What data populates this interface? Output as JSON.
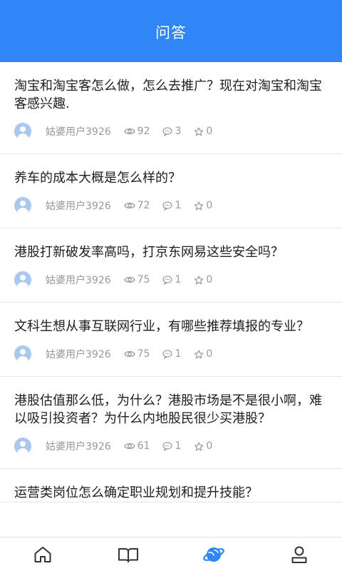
{
  "header": {
    "title": "问答"
  },
  "questions": [
    {
      "title": "淘宝和淘宝客怎么做，怎么去推广？现在对淘宝和淘宝客感兴趣.",
      "user": "姑婆用户3926",
      "views": "92",
      "comments": "3",
      "favorites": "0"
    },
    {
      "title": "养车的成本大概是怎么样的？",
      "user": "姑婆用户3926",
      "views": "72",
      "comments": "1",
      "favorites": "0"
    },
    {
      "title": "港股打新破发率高吗，打京东网易这些安全吗？",
      "user": "姑婆用户3926",
      "views": "75",
      "comments": "1",
      "favorites": "0"
    },
    {
      "title": "文科生想从事互联网行业，有哪些推荐填报的专业？",
      "user": "姑婆用户3926",
      "views": "75",
      "comments": "1",
      "favorites": "0"
    },
    {
      "title": "港股估值那么低，为什么？港股市场是不是很小啊，难以吸引投资者？为什么内地股民很少买港股？",
      "user": "姑婆用户3926",
      "views": "61",
      "comments": "1",
      "favorites": "0"
    },
    {
      "title": "运营类岗位怎么确定职业规划和提升技能？"
    }
  ],
  "tabbar": {
    "items": [
      {
        "icon": "home-icon",
        "active": false
      },
      {
        "icon": "book-icon",
        "active": false
      },
      {
        "icon": "planet-icon",
        "active": true
      },
      {
        "icon": "user-icon",
        "active": false
      }
    ],
    "active_color": "#2f86f6",
    "inactive_color": "#333333"
  }
}
